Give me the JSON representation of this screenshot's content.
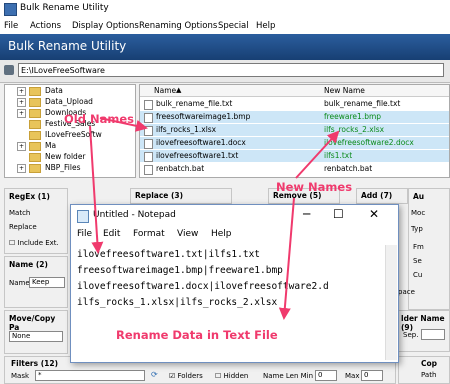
{
  "window": {
    "title": "Bulk Rename Utility"
  },
  "menu": [
    "File",
    "Actions",
    "Display Options",
    "Renaming Options",
    "Special",
    "Help"
  ],
  "banner": {
    "title": "Bulk Rename Utility"
  },
  "path": {
    "value": "E:\\ILoveFreeSoftware"
  },
  "tree": [
    "Data",
    "Data_Upload",
    "Downloads",
    "Festive_Sales",
    "ILoveFreeSoftw",
    "Ma",
    "New folder",
    "NBP_Files"
  ],
  "filelist": {
    "col_name": "Name",
    "col_newname": "New Name",
    "rows": [
      {
        "name": "bulk_rename_file.txt",
        "new": "bulk_rename_file.txt",
        "selected": false
      },
      {
        "name": "freesoftwareimage1.bmp",
        "new": "freeware1.bmp",
        "selected": true
      },
      {
        "name": "ilfs_rocks_1.xlsx",
        "new": "ilfs_rocks_2.xlsx",
        "selected": true
      },
      {
        "name": "ilovefreesoftware1.docx",
        "new": "ilovefreesoftware2.docx",
        "selected": true
      },
      {
        "name": "ilovefreesoftware1.txt",
        "new": "ilfs1.txt",
        "selected": true
      },
      {
        "name": "renbatch.bat",
        "new": "renbatch.bat",
        "selected": false
      }
    ]
  },
  "panels": {
    "regex": "RegEx (1)",
    "match": "Match",
    "replace_lbl": "Replace",
    "include_ext": "Include Ext.",
    "replace3": "Replace (3)",
    "remove5": "Remove (5)",
    "add7": "Add (7)",
    "auto": "Au",
    "mod": "Moc",
    "typ": "Typ",
    "fm": "Fm",
    "se": "Se",
    "cu": "Cu",
    "name2": "Name (2)",
    "name_lbl": "Name",
    "name_val": "Keep",
    "pace": "pace",
    "move_copy": "Move/Copy Pa",
    "move_val": "None",
    "folder_name": "lder Name (9)",
    "sep": "Sep.",
    "filters": "Filters (12)",
    "mask": "Mask",
    "mask_val": "*",
    "folders": "Folders",
    "hidden": "Hidden",
    "name_len_min": "Name Len Min",
    "min_val": "0",
    "max": "Max",
    "max_val": "0",
    "cop": "Cop",
    "path_lbl": "Path"
  },
  "notepad": {
    "title": "Untitled - Notepad",
    "menu": [
      "File",
      "Edit",
      "Format",
      "View",
      "Help"
    ],
    "lines": [
      "ilovefreesoftware1.txt|ilfs1.txt",
      "freesoftwareimage1.bmp|freeware1.bmp",
      "ilovefreesoftware1.docx|ilovefreesoftware2.d",
      "ilfs_rocks_1.xlsx|ilfs_rocks_2.xlsx"
    ]
  },
  "annotations": {
    "old_names": "Old Names",
    "new_names": "New Names",
    "rename_data": "Rename Data in Text File",
    "color": "#f03a6d"
  }
}
